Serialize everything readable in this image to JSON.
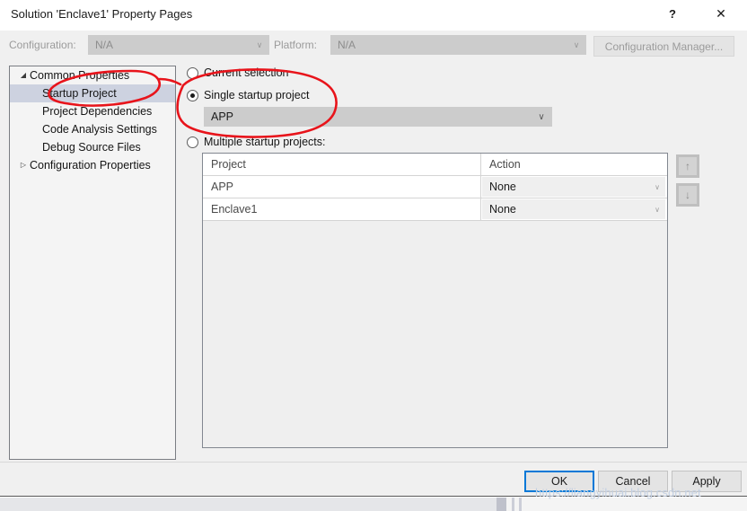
{
  "window": {
    "title": "Solution 'Enclave1' Property Pages",
    "help_glyph": "?",
    "close_glyph": "✕"
  },
  "config_bar": {
    "configuration_label": "Configuration:",
    "configuration_value": "N/A",
    "platform_label": "Platform:",
    "platform_value": "N/A",
    "configuration_manager_label": "Configuration Manager...",
    "dropdown_arrow": "∨"
  },
  "tree": {
    "nodes": [
      {
        "label": "Common Properties",
        "level": 1,
        "twisty": "◢",
        "selected": false
      },
      {
        "label": "Startup Project",
        "level": 2,
        "twisty": "",
        "selected": true
      },
      {
        "label": "Project Dependencies",
        "level": 2,
        "twisty": "",
        "selected": false
      },
      {
        "label": "Code Analysis Settings",
        "level": 2,
        "twisty": "",
        "selected": false
      },
      {
        "label": "Debug Source Files",
        "level": 2,
        "twisty": "",
        "selected": false
      },
      {
        "label": "Configuration Properties",
        "level": 1,
        "twisty": "▷",
        "selected": false
      }
    ]
  },
  "startup": {
    "current_selection_label": "Current selection",
    "single_startup_label": "Single startup project",
    "multiple_startup_label": "Multiple startup projects:",
    "selected_option": "single",
    "single_project_value": "APP",
    "dropdown_arrow": "∨"
  },
  "grid": {
    "columns": [
      "Project",
      "Action"
    ],
    "rows": [
      {
        "project": "APP",
        "action": "None"
      },
      {
        "project": "Enclave1",
        "action": "None"
      }
    ],
    "action_arrow": "∨"
  },
  "order_buttons": {
    "move_up": "↑",
    "move_down": "↓"
  },
  "footer": {
    "ok_label": "OK",
    "cancel_label": "Cancel",
    "apply_label": "Apply"
  },
  "watermark": {
    "text": "https://liangyihuai.blog.csdn.net"
  },
  "colors": {
    "accent": "#0078d7",
    "annotation": "#e8141b",
    "dialog_bg": "#f0f0f0",
    "tree_selection": "#cdd2e0"
  }
}
